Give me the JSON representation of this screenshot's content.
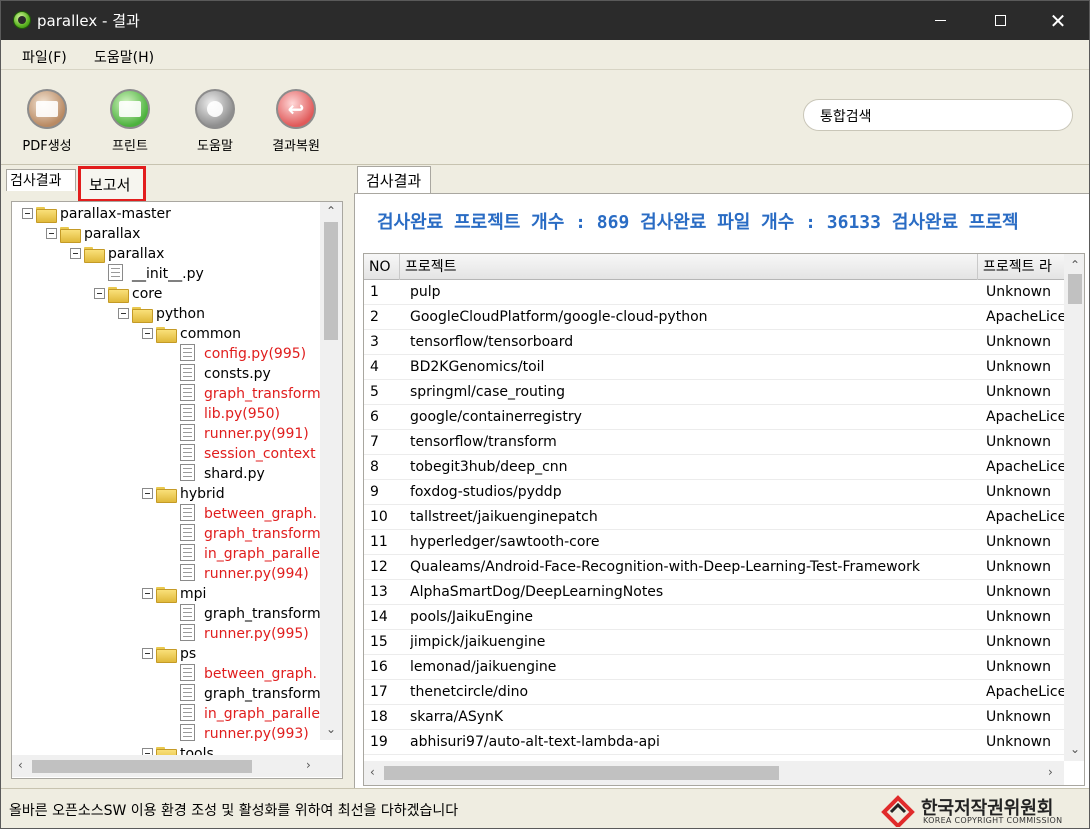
{
  "window": {
    "title": "parallex - 결과"
  },
  "menu": {
    "file": "파일(F)",
    "help": "도움말(H)"
  },
  "toolbar": {
    "pdf": "PDF생성",
    "print": "프린트",
    "help": "도움말",
    "restore": "결과복원",
    "search_placeholder": "통합검색"
  },
  "left_tabs": {
    "results": "검사결과",
    "report": "보고서"
  },
  "tree": [
    {
      "label": "parallax-master",
      "type": "folder",
      "level": 0,
      "red": false
    },
    {
      "label": "parallax",
      "type": "folder",
      "level": 1,
      "red": false
    },
    {
      "label": "parallax",
      "type": "folder",
      "level": 2,
      "red": false
    },
    {
      "label": "__init__.py",
      "type": "file",
      "level": 3,
      "red": false
    },
    {
      "label": "core",
      "type": "folder",
      "level": 3,
      "red": false
    },
    {
      "label": "python",
      "type": "folder",
      "level": 4,
      "red": false
    },
    {
      "label": "common",
      "type": "folder",
      "level": 5,
      "red": false
    },
    {
      "label": "config.py(995)",
      "type": "file",
      "level": 6,
      "red": true
    },
    {
      "label": "consts.py",
      "type": "file",
      "level": 6,
      "red": false
    },
    {
      "label": "graph_transform",
      "type": "file",
      "level": 6,
      "red": true
    },
    {
      "label": "lib.py(950)",
      "type": "file",
      "level": 6,
      "red": true
    },
    {
      "label": "runner.py(991)",
      "type": "file",
      "level": 6,
      "red": true
    },
    {
      "label": "session_context",
      "type": "file",
      "level": 6,
      "red": true
    },
    {
      "label": "shard.py",
      "type": "file",
      "level": 6,
      "red": false
    },
    {
      "label": "hybrid",
      "type": "folder",
      "level": 5,
      "red": false
    },
    {
      "label": "between_graph.",
      "type": "file",
      "level": 6,
      "red": true
    },
    {
      "label": "graph_transform",
      "type": "file",
      "level": 6,
      "red": true
    },
    {
      "label": "in_graph_paralle",
      "type": "file",
      "level": 6,
      "red": true
    },
    {
      "label": "runner.py(994)",
      "type": "file",
      "level": 6,
      "red": true
    },
    {
      "label": "mpi",
      "type": "folder",
      "level": 5,
      "red": false
    },
    {
      "label": "graph_transform",
      "type": "file",
      "level": 6,
      "red": false
    },
    {
      "label": "runner.py(995)",
      "type": "file",
      "level": 6,
      "red": true
    },
    {
      "label": "ps",
      "type": "folder",
      "level": 5,
      "red": false
    },
    {
      "label": "between_graph.",
      "type": "file",
      "level": 6,
      "red": true
    },
    {
      "label": "graph_transform",
      "type": "file",
      "level": 6,
      "red": false
    },
    {
      "label": "in_graph_paralle",
      "type": "file",
      "level": 6,
      "red": true
    },
    {
      "label": "runner.py(993)",
      "type": "file",
      "level": 6,
      "red": true
    },
    {
      "label": "tools",
      "type": "folder",
      "level": 5,
      "red": false
    }
  ],
  "right_tab": "검사결과",
  "summary": "검사완료 프로젝트 개수 : 869  검사완료 파일 개수 : 36133  검사완료 프로젝",
  "grid": {
    "headers": {
      "no": "NO",
      "project": "프로젝트",
      "license": "프로젝트 라"
    },
    "rows": [
      {
        "no": "1",
        "project": "pulp",
        "license": "Unknown"
      },
      {
        "no": "2",
        "project": "GoogleCloudPlatform/google-cloud-python",
        "license": "ApacheLicense"
      },
      {
        "no": "3",
        "project": "tensorflow/tensorboard",
        "license": "Unknown"
      },
      {
        "no": "4",
        "project": "BD2KGenomics/toil",
        "license": "Unknown"
      },
      {
        "no": "5",
        "project": "springml/case_routing",
        "license": "Unknown"
      },
      {
        "no": "6",
        "project": "google/containerregistry",
        "license": "ApacheLicense"
      },
      {
        "no": "7",
        "project": "tensorflow/transform",
        "license": "Unknown"
      },
      {
        "no": "8",
        "project": "tobegit3hub/deep_cnn",
        "license": "ApacheLicense"
      },
      {
        "no": "9",
        "project": "foxdog-studios/pyddp",
        "license": "Unknown"
      },
      {
        "no": "10",
        "project": "tallstreet/jaikuenginepatch",
        "license": "ApacheLicense"
      },
      {
        "no": "11",
        "project": "hyperledger/sawtooth-core",
        "license": "Unknown"
      },
      {
        "no": "12",
        "project": "Qualeams/Android-Face-Recognition-with-Deep-Learning-Test-Framework",
        "license": "Unknown"
      },
      {
        "no": "13",
        "project": "AlphaSmartDog/DeepLearningNotes",
        "license": "Unknown"
      },
      {
        "no": "14",
        "project": "pools/JaikuEngine",
        "license": "Unknown"
      },
      {
        "no": "15",
        "project": "jimpick/jaikuengine",
        "license": "Unknown"
      },
      {
        "no": "16",
        "project": "lemonad/jaikuengine",
        "license": "Unknown"
      },
      {
        "no": "17",
        "project": "thenetcircle/dino",
        "license": "ApacheLicense"
      },
      {
        "no": "18",
        "project": "skarra/ASynK",
        "license": "Unknown"
      },
      {
        "no": "19",
        "project": "abhisuri97/auto-alt-text-lambda-api",
        "license": "Unknown"
      }
    ]
  },
  "status": {
    "text": "올바른 오픈소스SW 이용 환경 조성 및 활성화를 위하여 최선을 다하겠습니다"
  },
  "logo": {
    "kr": "한국저작권위원회",
    "en": "KOREA COPYRIGHT COMMISSION"
  }
}
